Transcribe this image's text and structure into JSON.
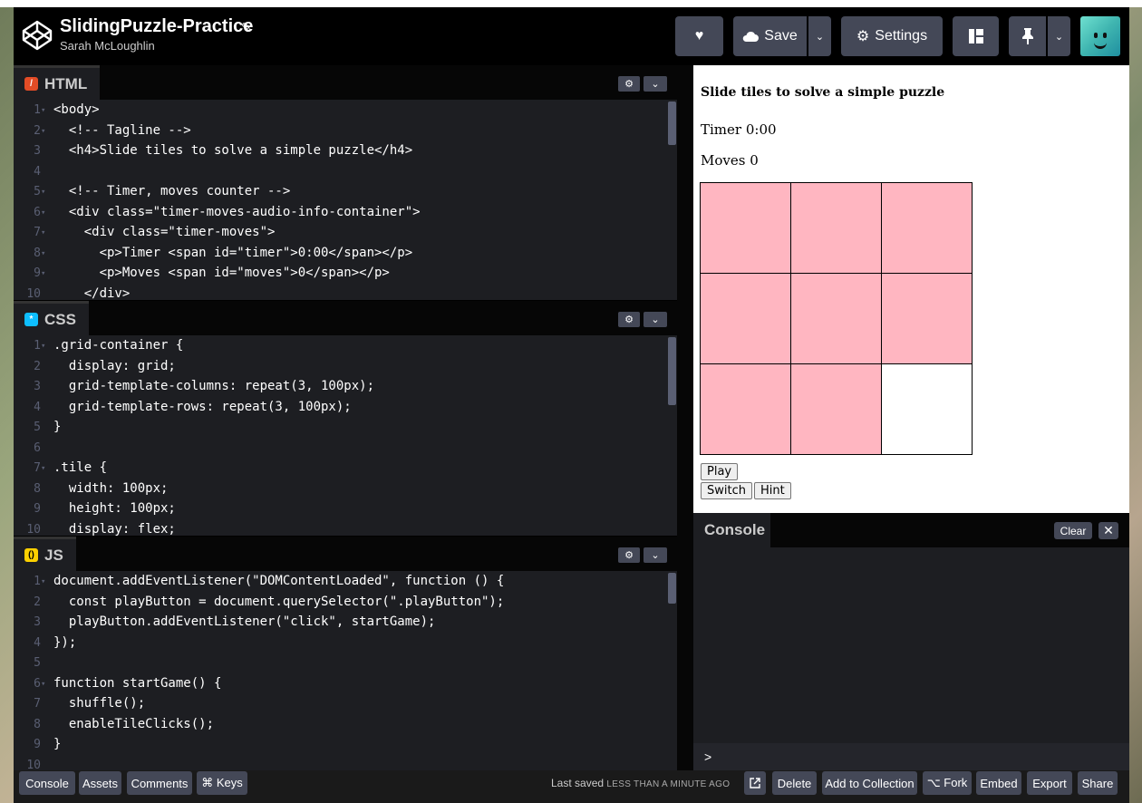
{
  "header": {
    "title": "SlidingPuzzle-Practice",
    "author": "Sarah McLoughlin",
    "save_label": "Save",
    "settings_label": "Settings"
  },
  "html_pane": {
    "title": "HTML",
    "icon": "html-icon",
    "lines": [
      {
        "n": "1",
        "text": "<body>"
      },
      {
        "n": "2",
        "text": "  <!-- Tagline -->"
      },
      {
        "n": "3",
        "text": "  <h4>Slide tiles to solve a simple puzzle</h4>"
      },
      {
        "n": "4",
        "text": ""
      },
      {
        "n": "5",
        "text": "  <!-- Timer, moves counter -->"
      },
      {
        "n": "6",
        "text": "  <div class=\"timer-moves-audio-info-container\">"
      },
      {
        "n": "7",
        "text": "    <div class=\"timer-moves\">"
      },
      {
        "n": "8",
        "text": "      <p>Timer <span id=\"timer\">0:00</span></p>"
      },
      {
        "n": "9",
        "text": "      <p>Moves <span id=\"moves\">0</span></p>"
      },
      {
        "n": "10",
        "text": "    </div>"
      }
    ]
  },
  "css_pane": {
    "title": "CSS",
    "icon": "css-icon",
    "lines": [
      {
        "n": "1",
        "text": ".grid-container {"
      },
      {
        "n": "2",
        "text": "  display: grid;"
      },
      {
        "n": "3",
        "text": "  grid-template-columns: repeat(3, 100px);"
      },
      {
        "n": "4",
        "text": "  grid-template-rows: repeat(3, 100px);"
      },
      {
        "n": "5",
        "text": "}"
      },
      {
        "n": "6",
        "text": ""
      },
      {
        "n": "7",
        "text": ".tile {"
      },
      {
        "n": "8",
        "text": "  width: 100px;"
      },
      {
        "n": "9",
        "text": "  height: 100px;"
      },
      {
        "n": "10",
        "text": "  display: flex;"
      }
    ]
  },
  "js_pane": {
    "title": "JS",
    "icon": "js-icon",
    "lines": [
      {
        "n": "1",
        "text": "document.addEventListener(\"DOMContentLoaded\", function () {"
      },
      {
        "n": "2",
        "text": "  const playButton = document.querySelector(\".playButton\");"
      },
      {
        "n": "3",
        "text": "  playButton.addEventListener(\"click\", startGame);"
      },
      {
        "n": "4",
        "text": "});"
      },
      {
        "n": "5",
        "text": ""
      },
      {
        "n": "6",
        "text": "function startGame() {"
      },
      {
        "n": "7",
        "text": "  shuffle();"
      },
      {
        "n": "8",
        "text": "  enableTileClicks();"
      },
      {
        "n": "9",
        "text": "}"
      },
      {
        "n": "10",
        "text": ""
      }
    ]
  },
  "preview": {
    "heading": "Slide tiles to solve a simple puzzle",
    "timer": "Timer 0:00",
    "moves": "Moves 0",
    "tiles": [
      "pink",
      "pink",
      "pink",
      "pink",
      "pink",
      "pink",
      "pink",
      "pink",
      "empty"
    ],
    "play_label": "Play",
    "switch_label": "Switch",
    "hint_label": "Hint"
  },
  "console": {
    "title": "Console",
    "clear_label": "Clear",
    "prompt": ">"
  },
  "footer": {
    "console_label": "Console",
    "assets_label": "Assets",
    "comments_label": "Comments",
    "keys_label": "⌘ Keys",
    "saved_prefix": "Last saved",
    "saved_time": "LESS THAN A MINUTE AGO",
    "delete_label": "Delete",
    "add_collection_label": "Add to Collection",
    "fork_label": "⌥ Fork",
    "embed_label": "Embed",
    "export_label": "Export",
    "share_label": "Share"
  },
  "colors": {
    "tile_pink": "#ffb6c1",
    "html_icon": "#e34c26",
    "css_icon": "#0ebeff",
    "js_icon": "#fcd000"
  }
}
